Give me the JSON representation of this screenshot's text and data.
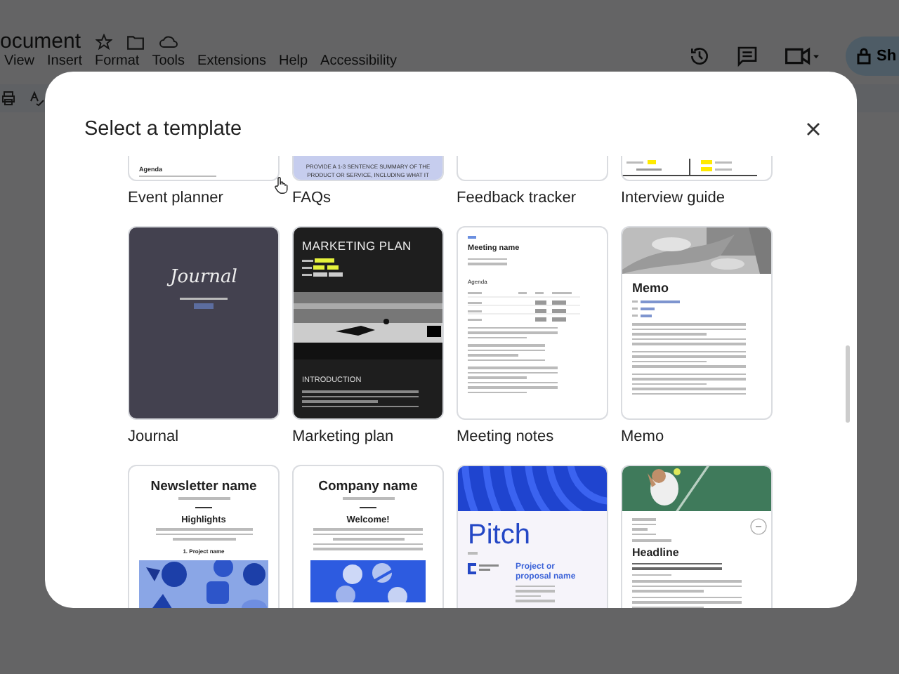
{
  "document": {
    "title": "ocument",
    "menu": [
      "View",
      "Insert",
      "Format",
      "Tools",
      "Extensions",
      "Help",
      "Accessibility"
    ],
    "share_label": "Sh"
  },
  "dialog": {
    "title": "Select a template"
  },
  "templates": [
    {
      "label": "Event planner",
      "kind": "event",
      "preview": {
        "heading": "Agenda"
      }
    },
    {
      "label": "FAQs",
      "kind": "faq",
      "preview": {
        "text": "PROVIDE A 1-3 SENTENCE SUMMARY OF THE PRODUCT OR SERVICE, INCLUDING WHAT IT"
      }
    },
    {
      "label": "Feedback tracker",
      "kind": "blank"
    },
    {
      "label": "Interview guide",
      "kind": "interview"
    },
    {
      "label": "Journal",
      "kind": "journal",
      "preview": {
        "title": "Journal"
      }
    },
    {
      "label": "Marketing plan",
      "kind": "marketing",
      "preview": {
        "title": "MARKETING PLAN",
        "section": "INTRODUCTION"
      }
    },
    {
      "label": "Meeting notes",
      "kind": "meeting",
      "preview": {
        "title": "Meeting name",
        "heading": "Agenda"
      }
    },
    {
      "label": "Memo",
      "kind": "memo",
      "preview": {
        "title": "Memo"
      }
    },
    {
      "kind": "newsletter",
      "preview": {
        "title": "Newsletter name",
        "heading": "Highlights",
        "item": "1. Project name"
      }
    },
    {
      "kind": "company",
      "preview": {
        "title": "Company name",
        "heading": "Welcome!"
      }
    },
    {
      "kind": "pitch",
      "preview": {
        "title": "Pitch",
        "subtitle": "Project or proposal name"
      }
    },
    {
      "kind": "headline",
      "preview": {
        "title": "Headline"
      }
    }
  ]
}
